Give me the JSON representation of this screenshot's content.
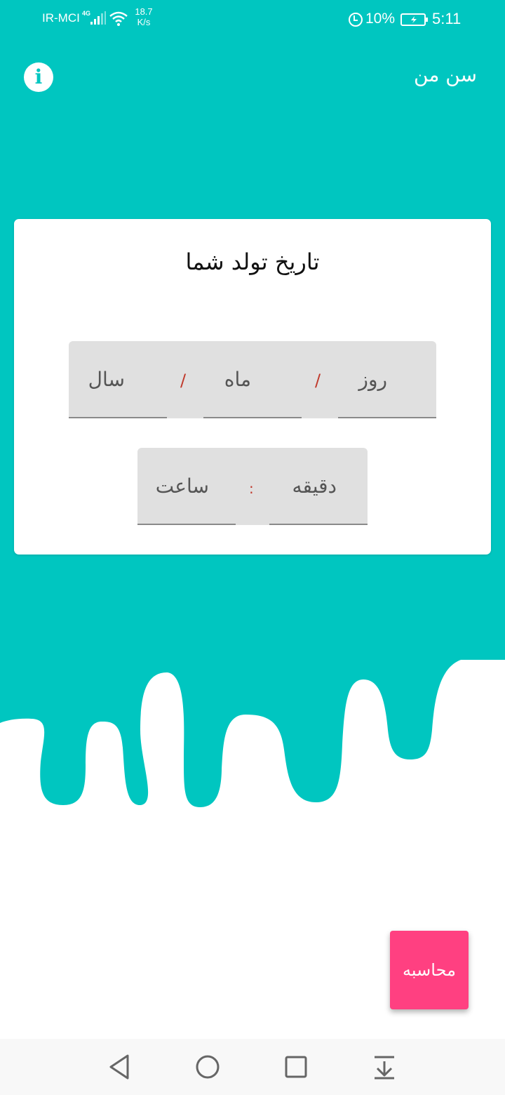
{
  "status_bar": {
    "carrier": "IR-MCI",
    "network_type": "4G",
    "speed_value": "18.7",
    "speed_unit": "K/s",
    "battery_percent": "10%",
    "time": "5:11"
  },
  "toolbar": {
    "title": "سن من",
    "info_glyph": "i"
  },
  "card": {
    "title": "تاریخ تولد شما",
    "date_fields": {
      "day_placeholder": "روز",
      "month_placeholder": "ماه",
      "year_placeholder": "سال",
      "separator": "/"
    },
    "time_fields": {
      "minute_placeholder": "دقیقه",
      "hour_placeholder": "ساعت",
      "separator": ":"
    }
  },
  "actions": {
    "calculate_label": "محاسبه"
  },
  "theme": {
    "primary": "#00C6C0",
    "accent": "#FF4081",
    "separator_color": "#C0392B"
  },
  "nav_icons": [
    "back-triangle-icon",
    "home-circle-icon",
    "recents-square-icon",
    "notification-pulldown-icon"
  ]
}
